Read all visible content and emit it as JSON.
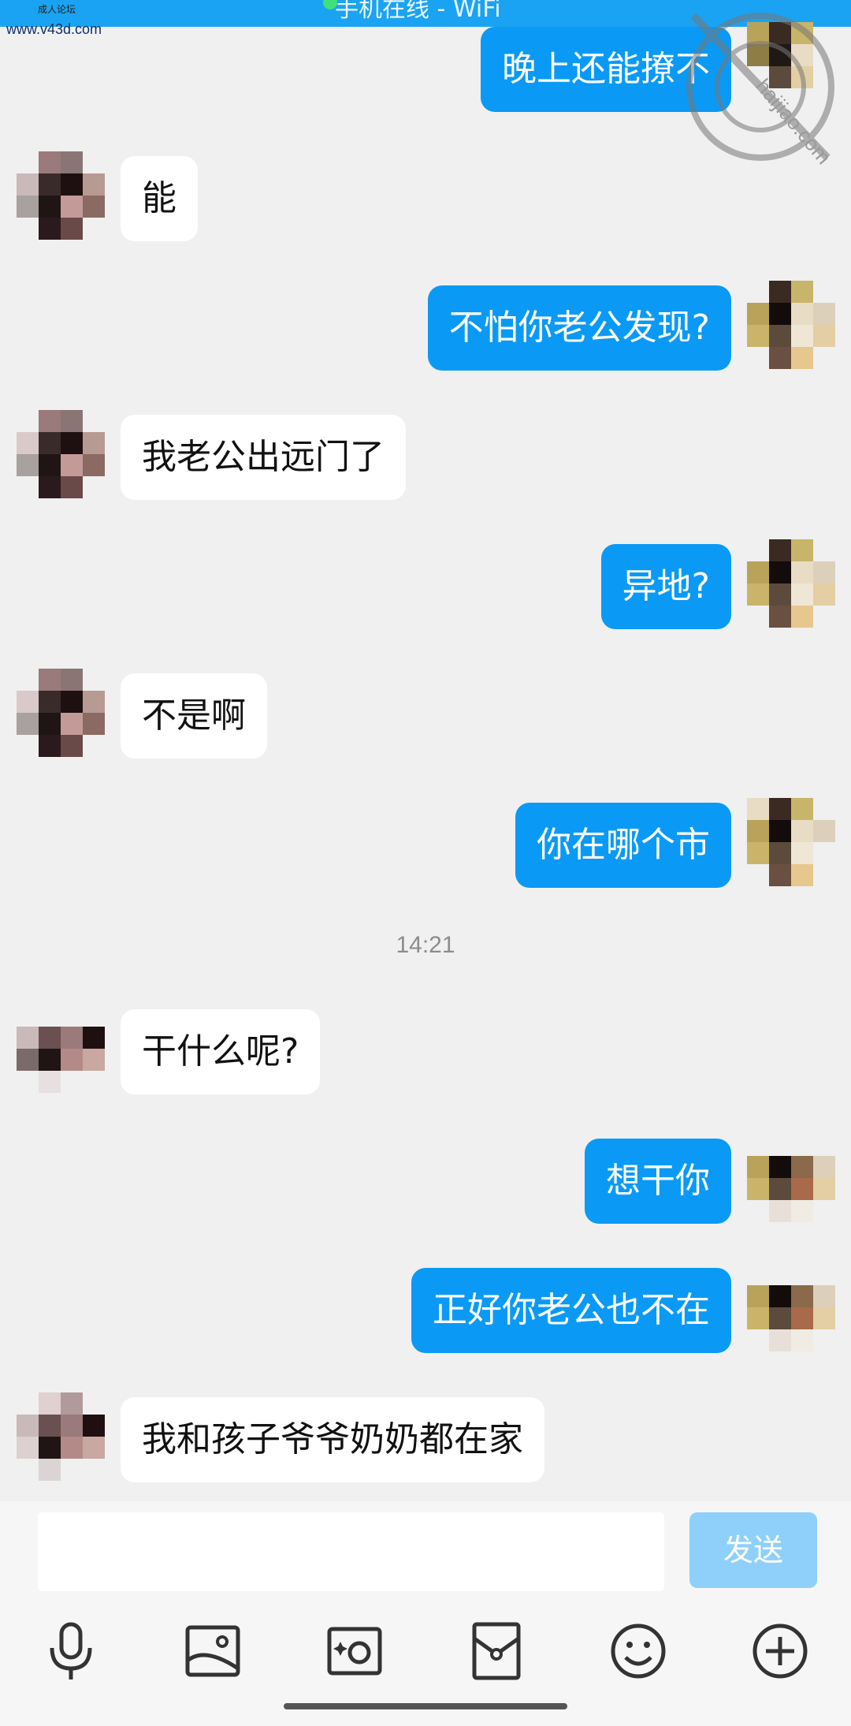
{
  "status": {
    "text": "手机在线 - WiFi"
  },
  "watermark": {
    "site": "www.v43d.com",
    "small": "成人论坛",
    "logo_text": "haijiao.com"
  },
  "messages": [
    {
      "side": "out",
      "text": "晚上还能撩不"
    },
    {
      "side": "in",
      "text": "能"
    },
    {
      "side": "out",
      "text": "不怕你老公发现?"
    },
    {
      "side": "in",
      "text": "我老公出远门了"
    },
    {
      "side": "out",
      "text": "异地?"
    },
    {
      "side": "in",
      "text": "不是啊"
    },
    {
      "side": "out",
      "text": "你在哪个市"
    },
    {
      "side": "in",
      "text": "干什么呢?"
    },
    {
      "side": "out",
      "text": "想干你"
    },
    {
      "side": "out",
      "text": "正好你老公也不在"
    },
    {
      "side": "in",
      "text": "我和孩子爷爷奶奶都在家"
    }
  ],
  "timestamp": "14:21",
  "input": {
    "placeholder": "",
    "send_label": "发送"
  },
  "toolbar": {
    "icons": [
      "microphone-icon",
      "image-icon",
      "camera-icon",
      "red-packet-icon",
      "emoji-icon",
      "plus-icon"
    ]
  },
  "colors": {
    "accent": "#0a9af5",
    "status_bar": "#1aa3f2",
    "send_disabled": "#8fd0fb"
  }
}
